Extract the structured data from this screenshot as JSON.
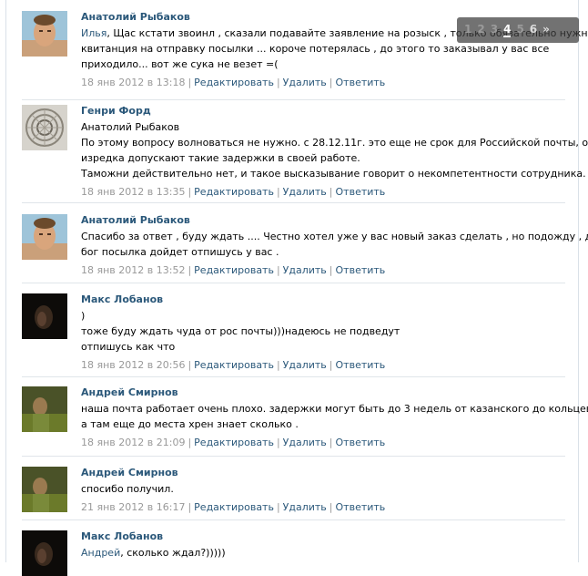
{
  "pagination": {
    "pages": [
      "1",
      "2",
      "3",
      "4",
      "5",
      "6"
    ],
    "current": "4",
    "next": "»"
  },
  "actions": {
    "edit": "Редактировать",
    "delete": "Удалить",
    "reply": "Ответить",
    "separator": "|"
  },
  "comments": [
    {
      "author": "Анатолий Рыбаков",
      "reply_to": "Илья",
      "lines": [
        ", Щас кстати звоинл , сказали подавайте заявление на розыск , только обязательно нужна",
        "квитанция на отправку посылки ... короче потерялась , до этого то заказывал у вас все",
        "приходило... вот же сука не везет =("
      ],
      "date": "18 янв 2012 в 13:18"
    },
    {
      "author": "Генри Форд",
      "reply_to": "",
      "lines": [
        "Анатолий Рыбаков",
        "По этому вопросу волноваться не нужно. с 28.12.11г. это еще не срок для Российской почты, они",
        "изредка допускают такие задержки в своей работе.",
        "Таможни действительно нет, и такое высказывание говорит о некомпетентности сотрудника."
      ],
      "date": "18 янв 2012 в 13:35"
    },
    {
      "author": "Анатолий Рыбаков",
      "reply_to": "",
      "lines": [
        "Спасибо за ответ , буду ждать .... Честно хотел уже у вас новый заказ сделать , но подожду , дай",
        "бог посылка дойдет отпишусь у вас ."
      ],
      "date": "18 янв 2012 в 13:52"
    },
    {
      "author": "Макс Лобанов",
      "reply_to": "",
      "lines": [
        ")",
        "тоже буду ждать чуда от рос почты)))надеюсь не подведут",
        "отпишусь как что"
      ],
      "date": "18 янв 2012 в 20:56"
    },
    {
      "author": "Андрей Смирнов",
      "reply_to": "",
      "lines": [
        "наша почта работает очень плохо. задержки могут быть до 3 недель от казанского до кольцевой",
        "а там еще до места хрен знает сколько ."
      ],
      "date": "18 янв 2012 в 21:09"
    },
    {
      "author": "Андрей Смирнов",
      "reply_to": "",
      "lines": [
        "спосибо получил."
      ],
      "date": "21 янв 2012 в 16:17"
    },
    {
      "author": "Макс Лобанов",
      "reply_to": "Андрей",
      "lines": [
        ", сколько ждал?)))))"
      ],
      "date": ""
    }
  ]
}
